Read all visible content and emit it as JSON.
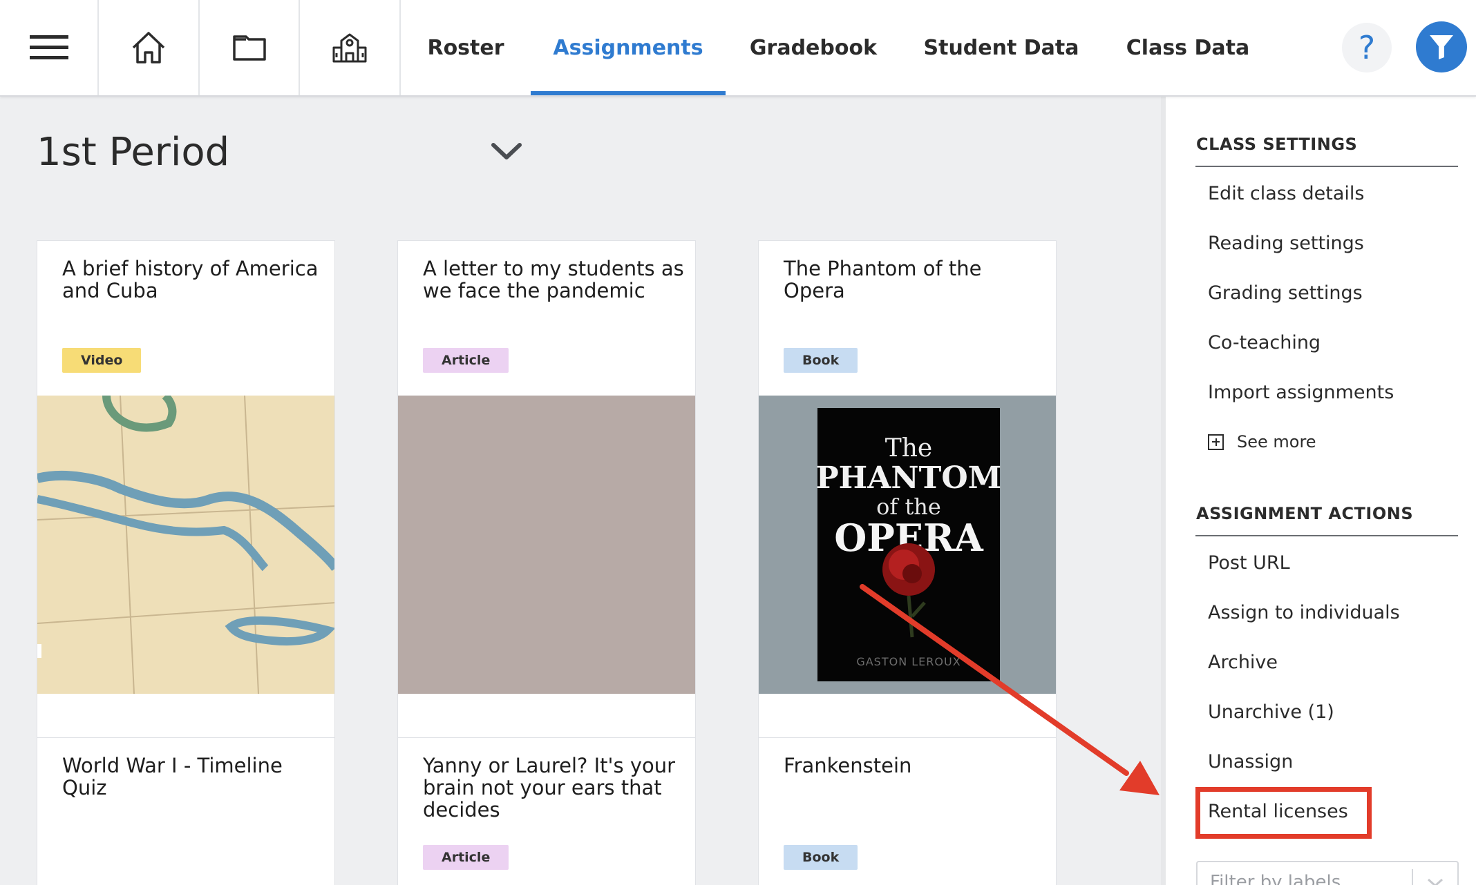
{
  "nav": {
    "icons": [
      "menu-icon",
      "home-icon",
      "folder-icon",
      "school-icon"
    ],
    "tabs": [
      {
        "label": "Roster",
        "active": false
      },
      {
        "label": "Assignments",
        "active": true
      },
      {
        "label": "Gradebook",
        "active": false
      },
      {
        "label": "Student Data",
        "active": false
      },
      {
        "label": "Class Data",
        "active": false
      }
    ],
    "help_label": "?",
    "accent_color": "#2f7bd0"
  },
  "main": {
    "period_title": "1st Period",
    "cards": [
      {
        "title": "A brief history of America and Cuba",
        "badge": "Video",
        "image": "map"
      },
      {
        "title": "A letter to my students as we face the pandemic",
        "badge": "Article",
        "image": "placeholder"
      },
      {
        "title": "The Phantom of the Opera",
        "badge": "Book",
        "image": "book-cover"
      },
      {
        "title": "World War I - Timeline Quiz",
        "badge": "",
        "image": ""
      },
      {
        "title": "Yanny or Laurel? It's your brain not your ears that decides",
        "badge": "Article",
        "image": ""
      },
      {
        "title": "Frankenstein",
        "badge": "Book",
        "image": ""
      }
    ],
    "book_cover": {
      "line1": "The",
      "line2": "PHANTOM",
      "line3": "of the",
      "line4": "OPERA",
      "author": "GASTON LEROUX"
    }
  },
  "sidebar": {
    "class_settings_header": "CLASS SETTINGS",
    "class_settings_items": [
      "Edit class details",
      "Reading settings",
      "Grading settings",
      "Co-teaching",
      "Import assignments"
    ],
    "see_more_label": "See more",
    "assignment_actions_header": "ASSIGNMENT ACTIONS",
    "assignment_actions_items": [
      "Post URL",
      "Assign to individuals",
      "Archive",
      "Unarchive (1)",
      "Unassign",
      "Rental licenses"
    ],
    "filter_placeholder": "Filter by labels",
    "highlight_color": "#e23c2a"
  }
}
